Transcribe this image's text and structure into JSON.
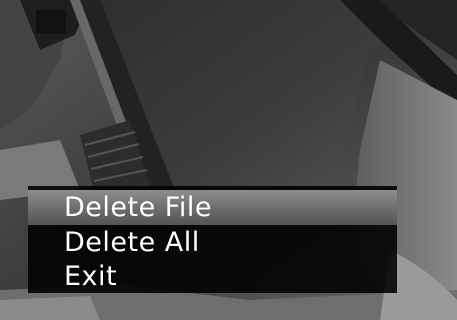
{
  "menu": {
    "items": [
      {
        "label": "Delete File",
        "selected": true
      },
      {
        "label": "Delete All",
        "selected": false
      },
      {
        "label": "Exit",
        "selected": false
      }
    ]
  },
  "colors": {
    "menu_background": "#000000",
    "selected_highlight": "#7a7a7a",
    "menu_text": "#ffffff"
  }
}
